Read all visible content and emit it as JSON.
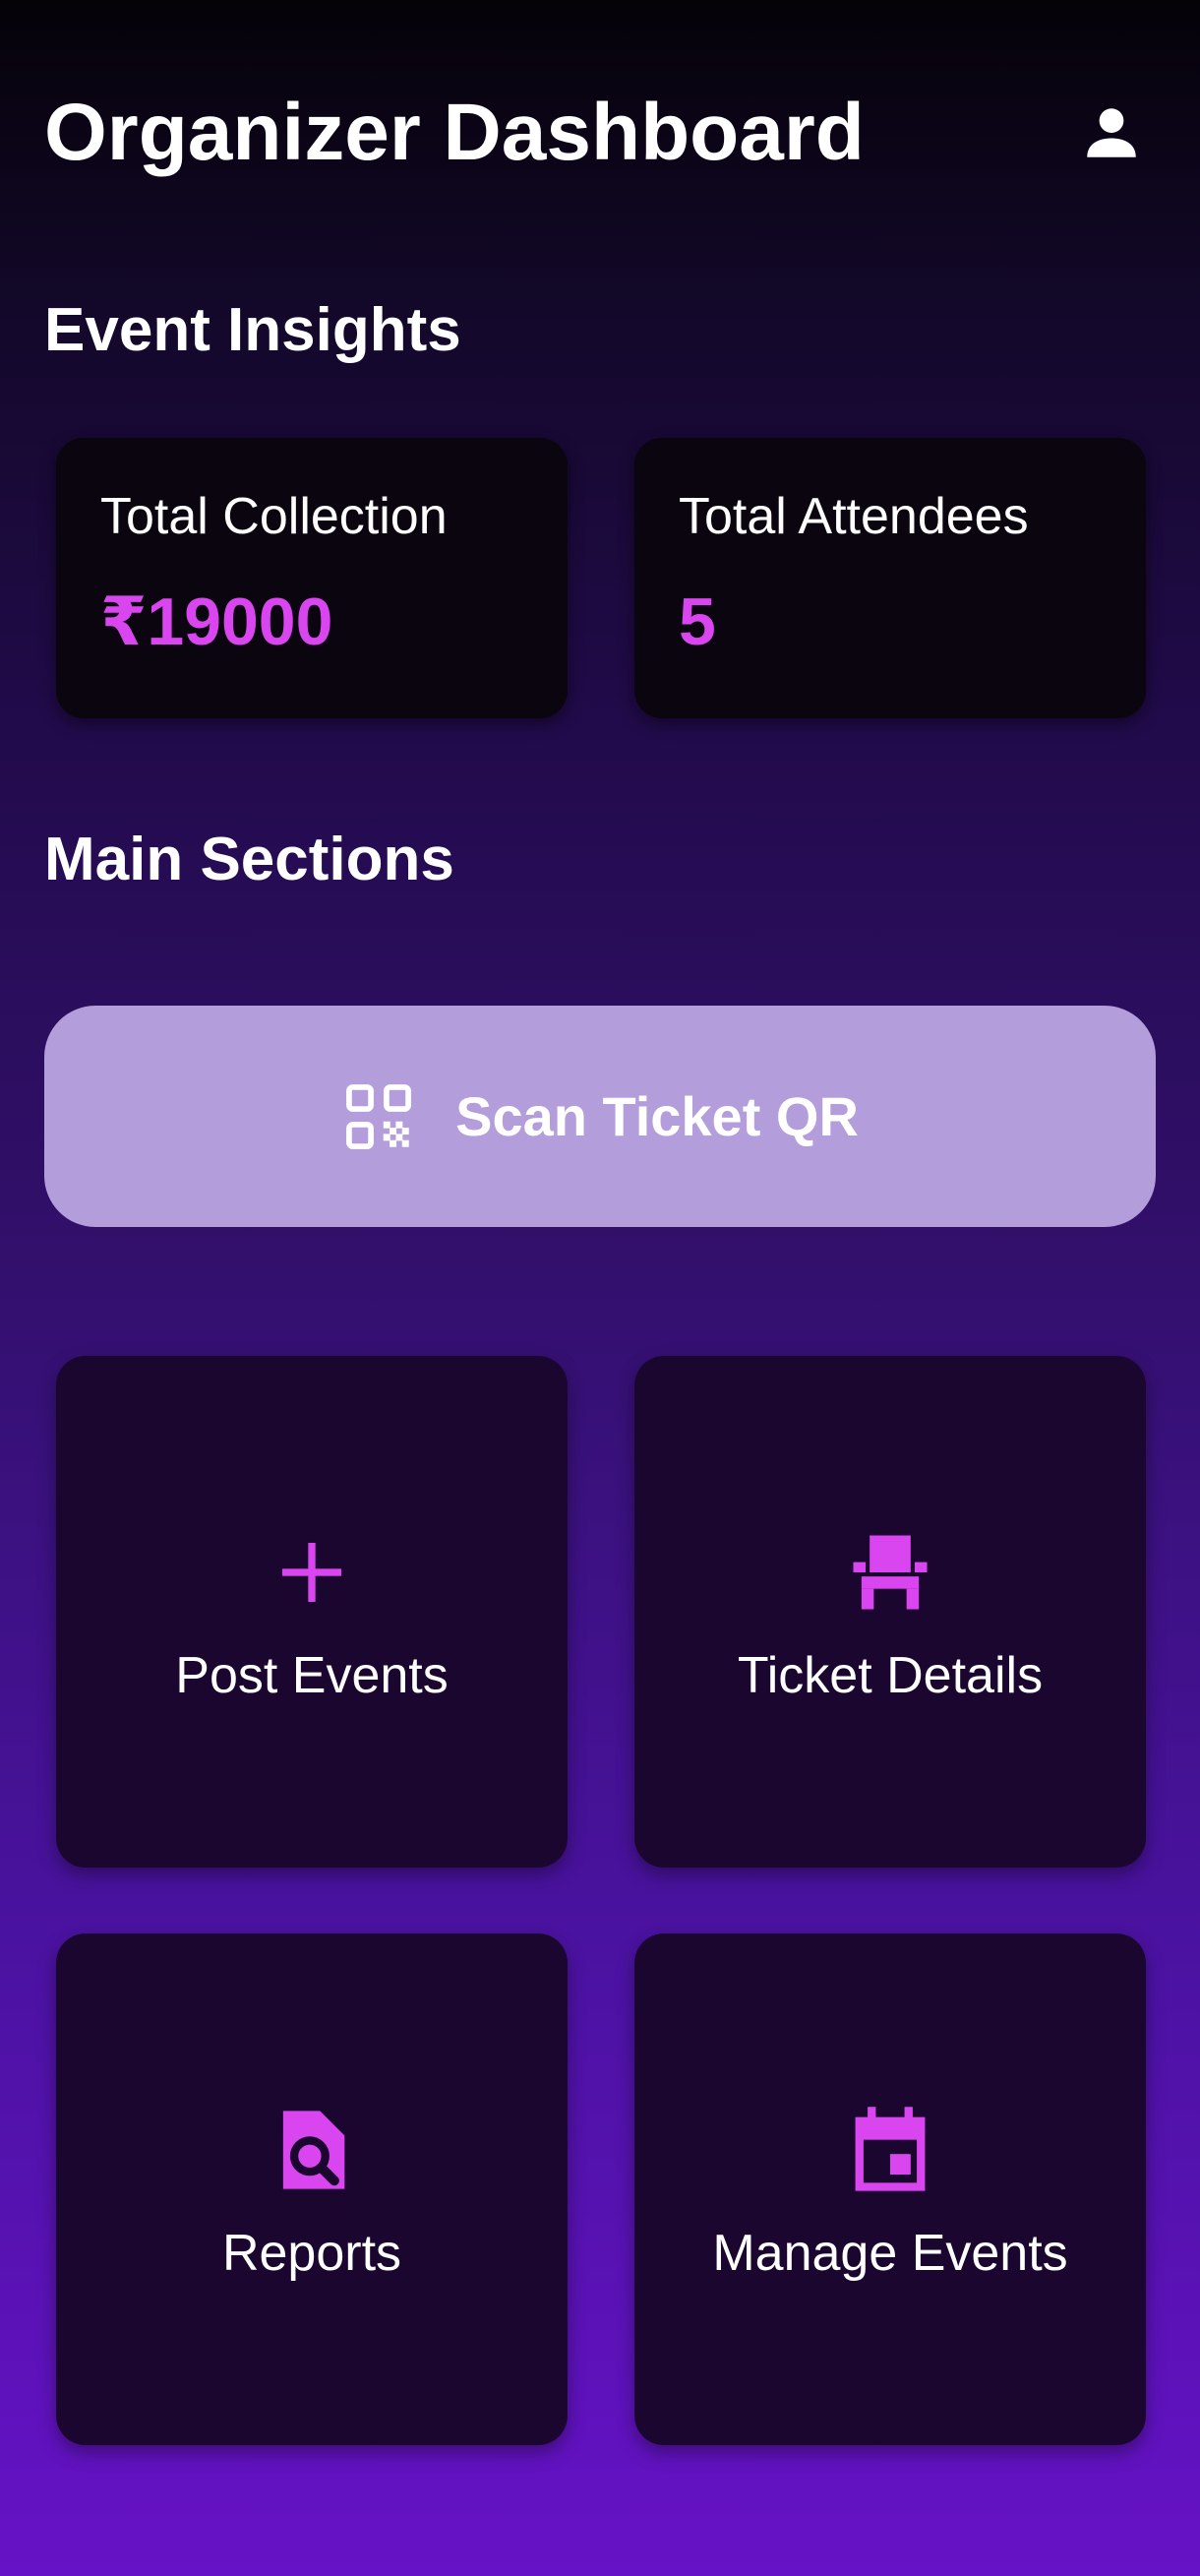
{
  "header": {
    "title": "Organizer Dashboard",
    "profile_icon": "person-icon"
  },
  "insights": {
    "section_title": "Event Insights",
    "cards": [
      {
        "label": "Total Collection",
        "value": "₹19000"
      },
      {
        "label": "Total Attendees",
        "value": "5"
      }
    ]
  },
  "main": {
    "section_title": "Main Sections",
    "scan_button": {
      "label": "Scan Ticket QR",
      "icon": "qr-code-icon"
    },
    "tiles": [
      {
        "label": "Post Events",
        "icon": "plus-icon"
      },
      {
        "label": "Ticket Details",
        "icon": "seat-icon"
      },
      {
        "label": "Reports",
        "icon": "document-search-icon"
      },
      {
        "label": "Manage Events",
        "icon": "calendar-icon"
      }
    ]
  },
  "colors": {
    "accent": "#d946ef",
    "card_dark": "#0b0510",
    "tile_bg": "#1b0630",
    "scan_button_bg": "#b39ddb",
    "gradient_top": "#050208",
    "gradient_bottom": "#6612c6"
  }
}
